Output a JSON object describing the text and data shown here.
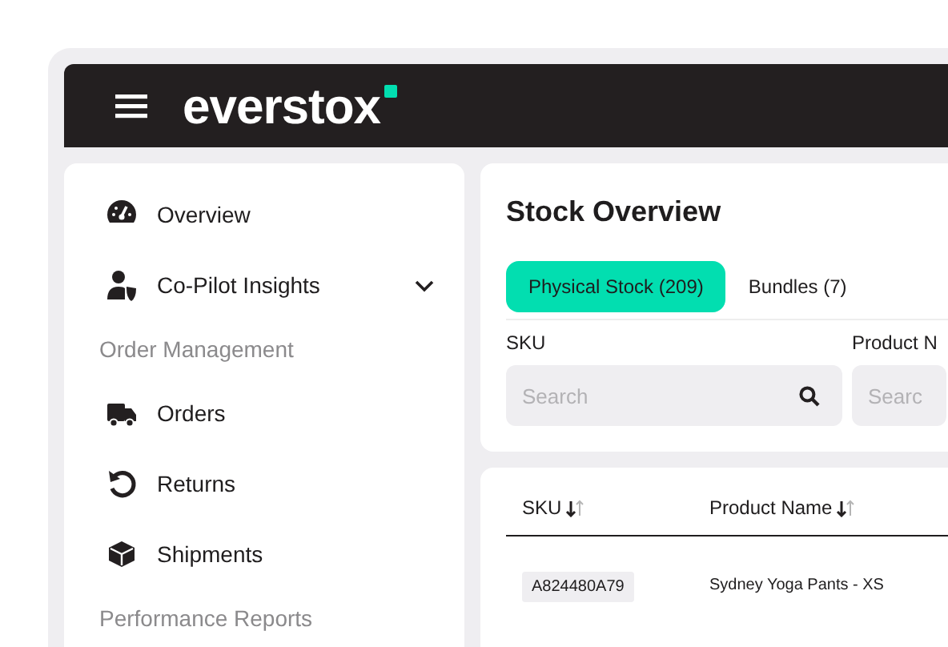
{
  "header": {
    "logo": "everstox"
  },
  "sidebar": {
    "items": [
      {
        "kind": "link",
        "label": "Overview"
      },
      {
        "kind": "group",
        "label": "Co-Pilot Insights",
        "expanded": false
      },
      {
        "kind": "section",
        "label": "Order Management"
      },
      {
        "kind": "link",
        "label": "Orders"
      },
      {
        "kind": "link",
        "label": "Returns"
      },
      {
        "kind": "link",
        "label": "Shipments"
      },
      {
        "kind": "section",
        "label": "Performance Reports"
      }
    ]
  },
  "page": {
    "title": "Stock Overview",
    "tabs": [
      {
        "label": "Physical Stock (209)",
        "selected": true
      },
      {
        "label": "Bundles (7)",
        "selected": false
      }
    ],
    "filters": [
      {
        "label": "SKU",
        "placeholder": "Search"
      },
      {
        "label": "Product N",
        "placeholder": "Searc"
      }
    ]
  },
  "table": {
    "columns": [
      "SKU",
      "Product Name"
    ],
    "rows": [
      {
        "sku": "A824480A79",
        "product_name": "Sydney Yoga Pants - XS"
      }
    ]
  }
}
